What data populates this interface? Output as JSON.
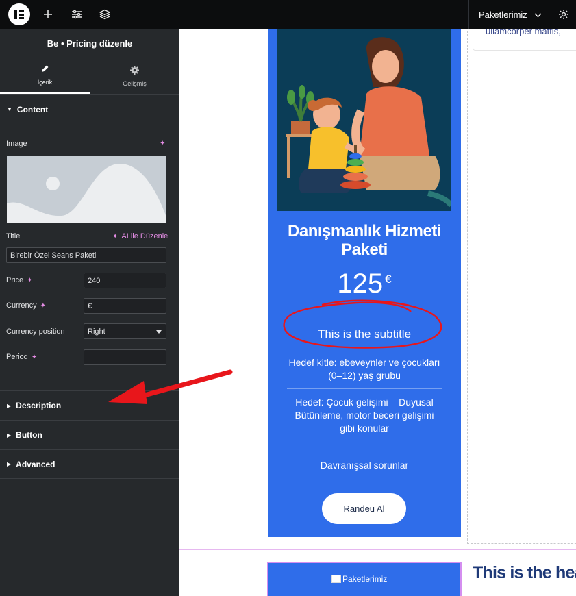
{
  "topbar": {
    "icons": [
      "elementor-logo-icon",
      "plus-icon",
      "sliders-icon",
      "layers-icon",
      "settings-icon"
    ],
    "page_menu_label": "Paketlerimiz"
  },
  "panel": {
    "title": "Be • Pricing düzenle",
    "tabs": [
      {
        "label": "İçerik",
        "icon": "pencil-icon",
        "active": true
      },
      {
        "label": "Gelişmiş",
        "icon": "gear-icon",
        "active": false
      }
    ],
    "content_section": "Content",
    "image_label": "Image",
    "title_label": "Title",
    "ai_edit_label": "AI ile Düzenle",
    "title_value": "Birebir Özel Seans Paketi",
    "price_label": "Price",
    "price_value": "240",
    "currency_label": "Currency",
    "currency_value": "€",
    "currency_position_label": "Currency position",
    "currency_position_value": "Right",
    "period_label": "Period",
    "period_value": "",
    "sections": [
      "Description",
      "Button",
      "Advanced"
    ]
  },
  "canvas": {
    "right_top_text": "ullamcorper mattis,",
    "card": {
      "title": "Danışmanlık Hizmeti Paketi",
      "price": "125",
      "currency": "€",
      "subtitle": "This is the subtitle",
      "features": [
        "Hedef kitle: ebeveynler ve çocukları (0–12) yaş grubu",
        "Hedef: Çocuk gelişimi – Duyusal Bütünleme, motor beceri gelişimi gibi konular",
        "Davranışsal sorunlar"
      ],
      "button_label": "Randeu Al"
    },
    "card2_img_alt": "Paketlerimiz",
    "heading2": "This is the hea"
  },
  "colors": {
    "accent_blue": "#2f6dea",
    "panel_bg": "#26292c",
    "annotation_red": "#e8161b"
  }
}
